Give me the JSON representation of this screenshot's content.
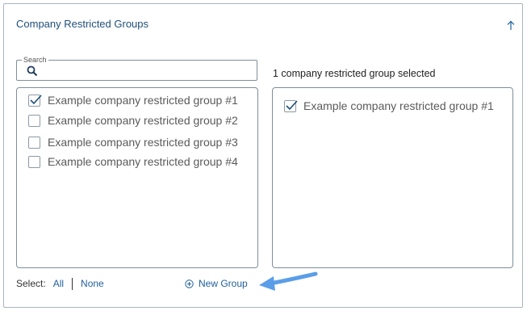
{
  "panel": {
    "title": "Company Restricted Groups",
    "collapse_icon": "arrow-up-icon"
  },
  "search": {
    "label": "Search",
    "value": "",
    "placeholder": "",
    "icon": "search-icon"
  },
  "selection": {
    "summary": "1 company restricted group selected"
  },
  "groups": [
    {
      "label": "Example company restricted group #1",
      "checked": true
    },
    {
      "label": "Example company restricted group #2",
      "checked": false
    },
    {
      "label": "Example company restricted group #3",
      "checked": false
    },
    {
      "label": "Example company restricted group #4",
      "checked": false
    }
  ],
  "selected_groups": [
    {
      "label": "Example company restricted group #1",
      "checked": true
    }
  ],
  "footer": {
    "select_label": "Select:",
    "all_label": "All",
    "none_label": "None",
    "new_group_label": "New Group",
    "new_group_icon": "plus-circle-icon"
  },
  "annotation": {
    "arrow_color": "#5b9ee8"
  },
  "colors": {
    "title": "#1e4f78",
    "link": "#1e5f99",
    "border": "#a9b3bd"
  }
}
